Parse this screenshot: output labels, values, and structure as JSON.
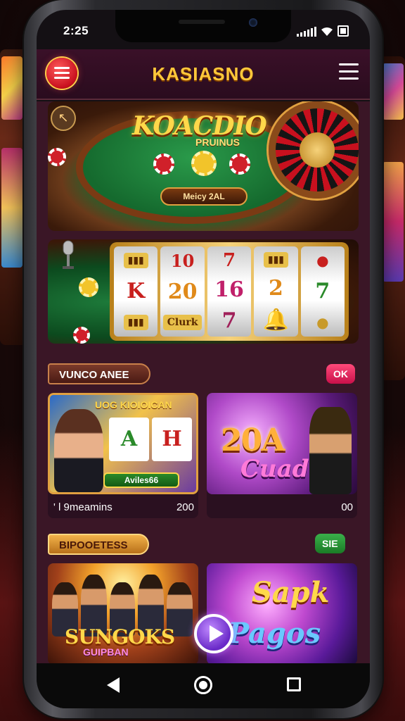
{
  "status_bar": {
    "time": "2:25"
  },
  "header": {
    "title": "KASIASNO"
  },
  "hero": {
    "title": "KOACDIO",
    "subtitle": "PRUINUS",
    "button_label": "Meicy 2AL"
  },
  "slots_reels": [
    {
      "top": "",
      "mid": "K",
      "bot": ""
    },
    {
      "top": "10",
      "mid": "20",
      "bot": "Clurk"
    },
    {
      "top": "7",
      "mid": "16",
      "bot": "7"
    },
    {
      "top": "",
      "mid": "2",
      "bot": ""
    },
    {
      "top": "",
      "mid": "7",
      "bot": ""
    }
  ],
  "section_1": {
    "label": "VUNCO ANEE",
    "action": "OK"
  },
  "game_a": {
    "title": "UOG KIOIOICAN",
    "reels": [
      "A",
      "H"
    ],
    "badge": "Aviles66",
    "meta_left": "' l  9meamins",
    "meta_right": "200"
  },
  "game_b": {
    "big": "20A",
    "word": "Cuad",
    "meta_right": "00"
  },
  "section_2": {
    "label": "BIPOOETESS",
    "action": "SIE"
  },
  "game_c": {
    "title": "SUNGOKS",
    "subtitle": "GUIPBAN"
  },
  "game_d": {
    "line1": "Sapk",
    "line2": "Pagos"
  },
  "colors": {
    "accent": "#ffc83a",
    "background": "#3a1626"
  }
}
